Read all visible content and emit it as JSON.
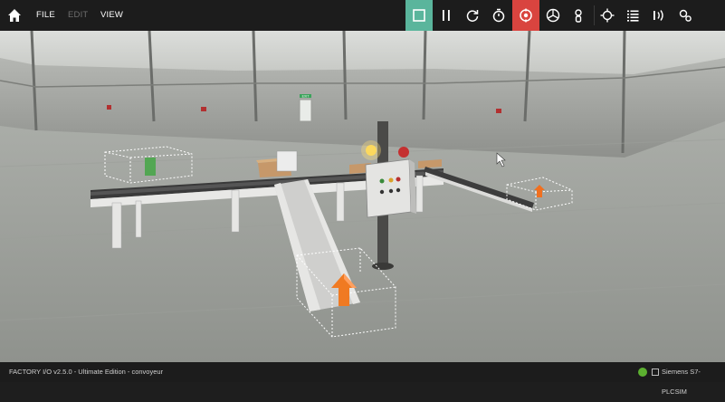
{
  "menu": {
    "file": "FILE",
    "edit": "EDIT",
    "view": "VIEW"
  },
  "toolbar": {
    "icons": [
      "home-icon",
      "stop-icon",
      "pause-icon",
      "reset-icon",
      "timer-icon",
      "drivers-icon",
      "camera-orbit-icon",
      "camera-fly-icon",
      "camera-first-person-icon",
      "sensor-icon",
      "list-icon",
      "io-icon",
      "settings-icon"
    ],
    "active_color": "#5ab59c",
    "alert_color": "#d9443f"
  },
  "status": {
    "left_text": "FACTORY I/O v2.5.0 - Ultimate Edition - convoyeur",
    "driver_label": "Siemens S7-PLCSIM",
    "ok_color": "#5cb030"
  },
  "scene": {
    "exit_sign": "EXIT"
  }
}
